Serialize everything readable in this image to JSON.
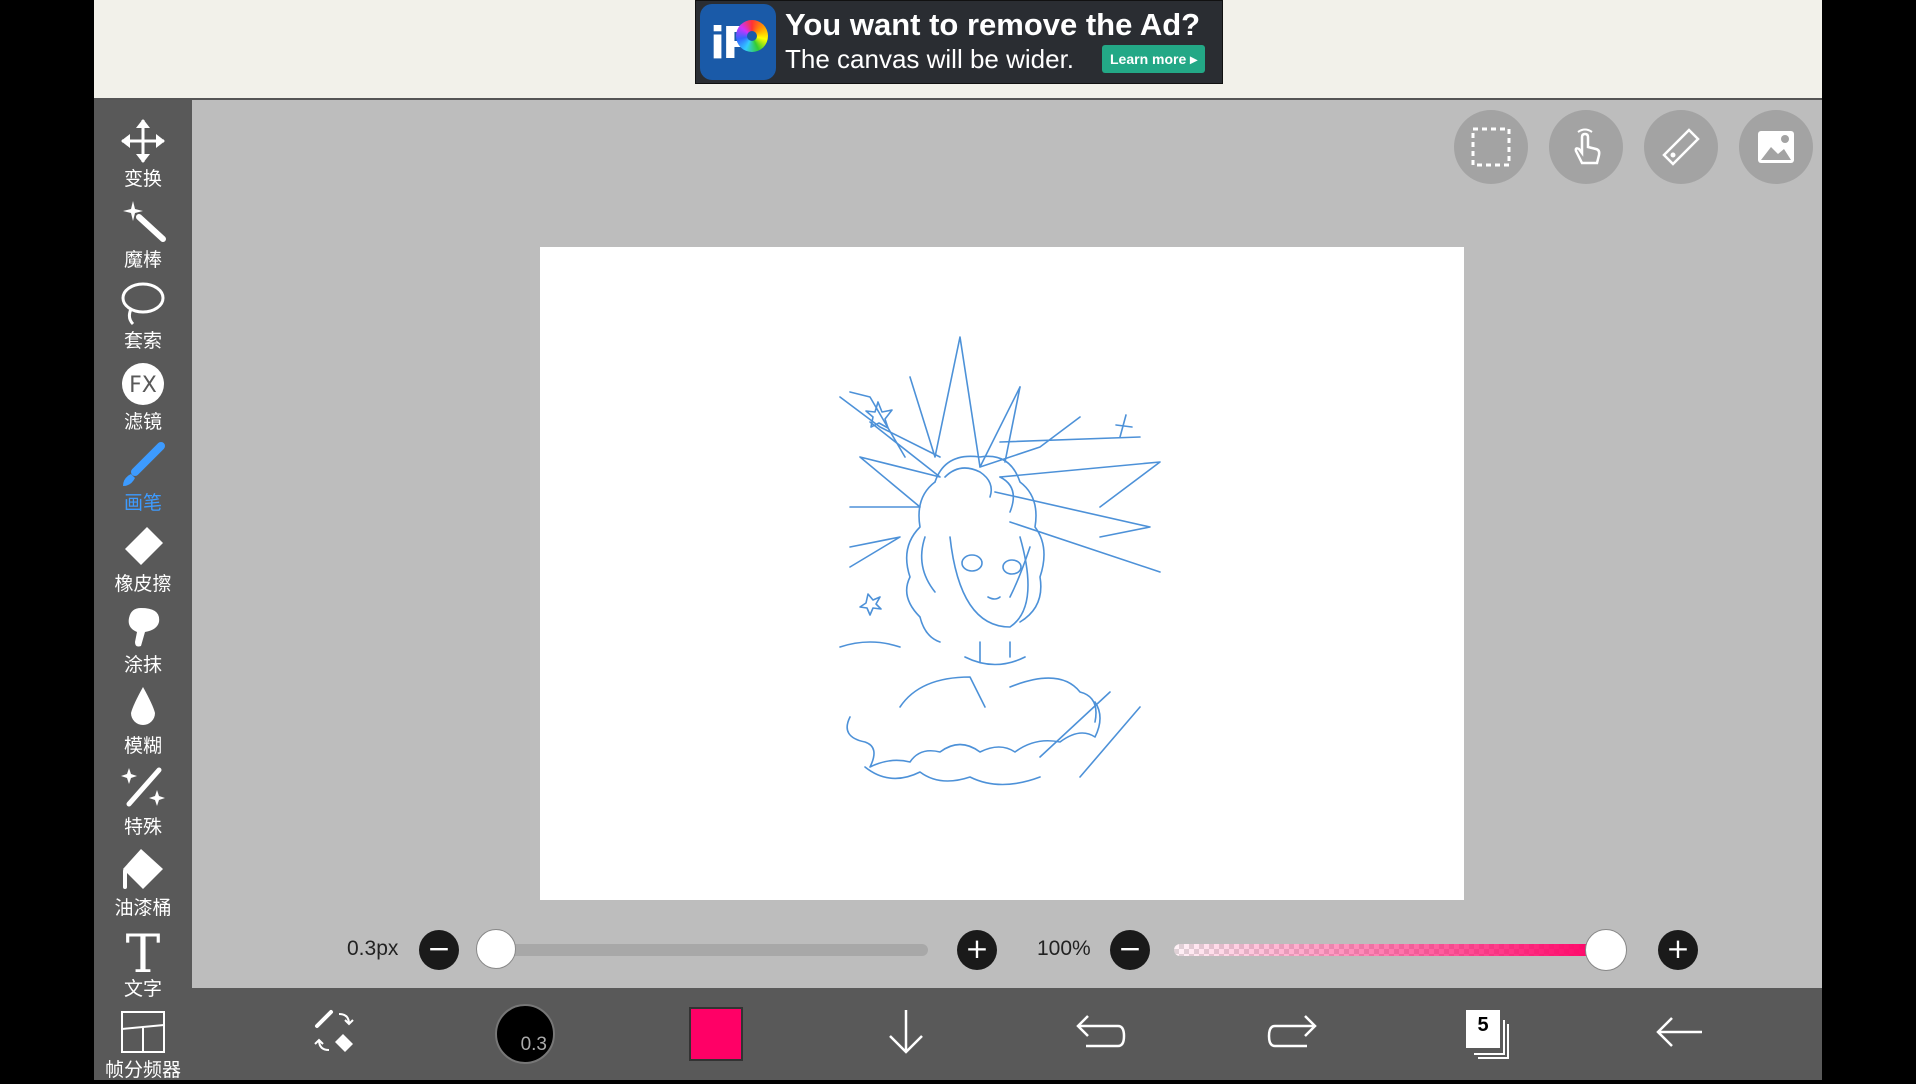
{
  "ad": {
    "title": "You want to remove the Ad?",
    "subtitle": "The canvas will be wider.",
    "learn_more": "Learn more ▸",
    "logo_text": "iP"
  },
  "tools": [
    {
      "label": "变换",
      "icon": "move-arrows-icon"
    },
    {
      "label": "魔棒",
      "icon": "magic-wand-icon"
    },
    {
      "label": "套索",
      "icon": "lasso-icon"
    },
    {
      "label": "滤镜",
      "icon": "fx-filter-icon"
    },
    {
      "label": "画笔",
      "icon": "brush-icon",
      "active": true
    },
    {
      "label": "橡皮擦",
      "icon": "eraser-icon"
    },
    {
      "label": "涂抹",
      "icon": "smudge-icon"
    },
    {
      "label": "模糊",
      "icon": "blur-drop-icon"
    },
    {
      "label": "特殊",
      "icon": "special-sparkle-icon"
    },
    {
      "label": "油漆桶",
      "icon": "paint-bucket-icon"
    },
    {
      "label": "文字",
      "icon": "text-icon"
    },
    {
      "label": "帧分频器",
      "icon": "frame-divider-icon"
    }
  ],
  "top_actions": [
    "selection-icon",
    "hand-pointer-icon",
    "ruler-icon",
    "image-icon"
  ],
  "brush": {
    "size_label": "0.3px",
    "size_fraction": 0.0,
    "opacity_label": "100%",
    "opacity_fraction": 1.0,
    "preview_value": "0.3"
  },
  "colors": {
    "primary": "#ff0066",
    "active_tool": "#3d9bff",
    "sketch_line": "#3a86d4"
  },
  "layers": {
    "count": "5"
  }
}
